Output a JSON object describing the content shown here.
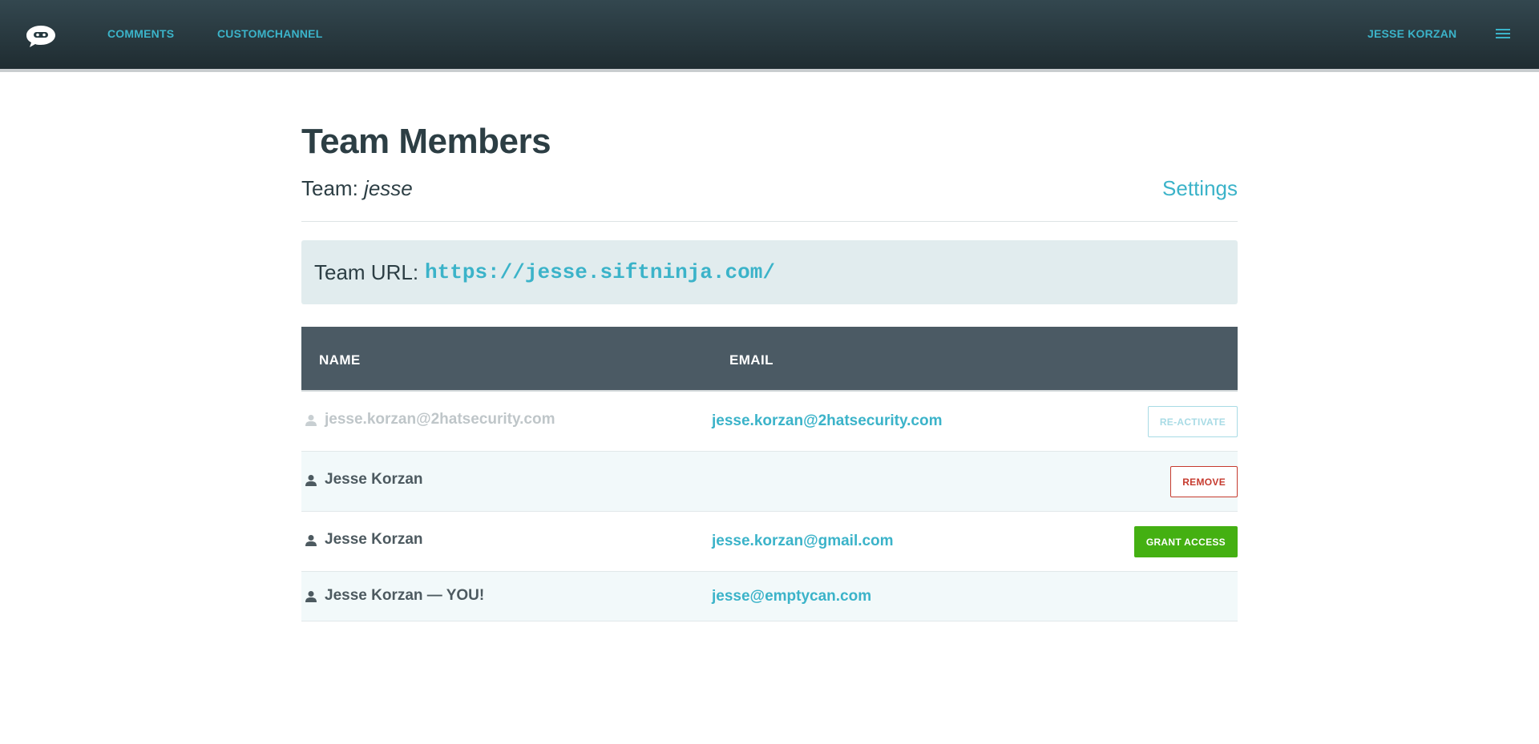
{
  "nav": {
    "logo": "chat-bubble-ninja-logo",
    "links": [
      "COMMENTS",
      "CUSTOMCHANNEL"
    ],
    "user": "JESSE KORZAN",
    "menu_icon": "hamburger-menu-icon"
  },
  "header": {
    "title": "Team Members",
    "team_label": "Team:",
    "team_name": "jesse",
    "settings_label": "Settings"
  },
  "team_url": {
    "label": "Team URL:",
    "value": "https://jesse.siftninja.com/"
  },
  "table": {
    "columns": [
      "NAME",
      "EMAIL"
    ],
    "rows": [
      {
        "name": "jesse.korzan@2hatsecurity.com",
        "email": "jesse.korzan@2hatsecurity.com",
        "action": "RE-ACTIVATE",
        "inactive": true
      },
      {
        "name": "Jesse Korzan",
        "email": "",
        "action": "REMOVE"
      },
      {
        "name": "Jesse Korzan",
        "email": "jesse.korzan@gmail.com",
        "action": "GRANT ACCESS"
      },
      {
        "name": "Jesse Korzan — YOU!",
        "email": "jesse@emptycan.com",
        "action": ""
      }
    ]
  },
  "colors": {
    "accent": "#3bb3c9",
    "header_bg": "#4b5a64",
    "danger": "#c63a2e",
    "success": "#44b012"
  }
}
